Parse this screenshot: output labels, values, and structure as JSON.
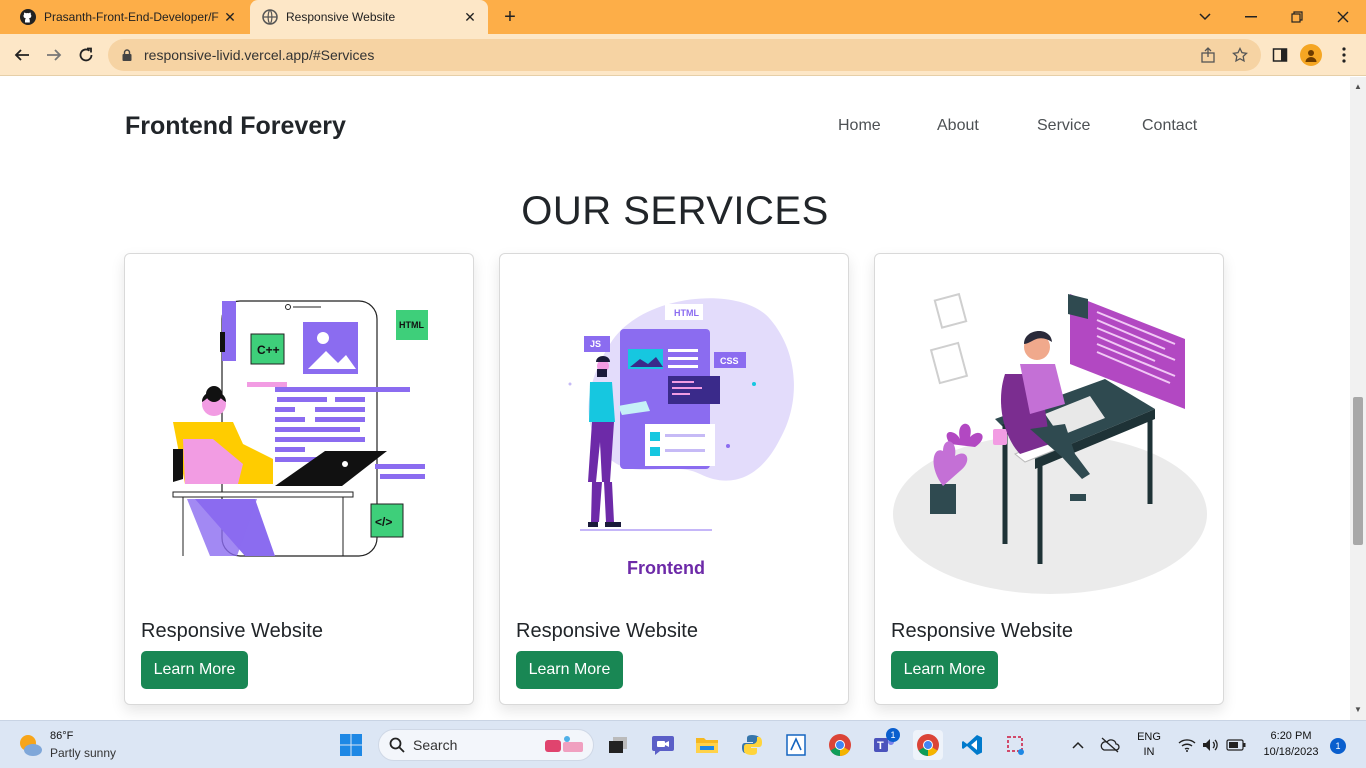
{
  "browser": {
    "tabs": [
      {
        "title": "Prasanth-Front-End-Developer/F",
        "close_glyph": "✕"
      },
      {
        "title": "Responsive Website",
        "close_glyph": "✕"
      }
    ],
    "new_tab_glyph": "+",
    "url": "responsive-livid.vercel.app/#Services",
    "accent_color": "#fdae48"
  },
  "site": {
    "brand": "Frontend Forevery",
    "nav": [
      "Home",
      "About",
      "Service",
      "Contact"
    ],
    "section_title": "OUR SERVICES",
    "cards": [
      {
        "title": "Responsive Website",
        "button": "Learn More",
        "illustration": "developer-with-laptop-code",
        "tags": [
          "C++",
          "HTML",
          "</>"
        ]
      },
      {
        "title": "Responsive Website",
        "button": "Learn More",
        "illustration": "frontend-developer",
        "tags": [
          "HTML",
          "JS",
          "CSS",
          "Frontend"
        ]
      },
      {
        "title": "Responsive Website",
        "button": "Learn More",
        "illustration": "developer-at-desk",
        "tags": []
      }
    ],
    "button_color": "#198754"
  },
  "taskbar": {
    "weather_temp": "86°F",
    "weather_desc": "Partly sunny",
    "search_label": "Search",
    "lang_line1": "ENG",
    "lang_line2": "IN",
    "time": "6:20 PM",
    "date": "10/18/2023",
    "notification_count": "1",
    "teams_badge": "1"
  }
}
